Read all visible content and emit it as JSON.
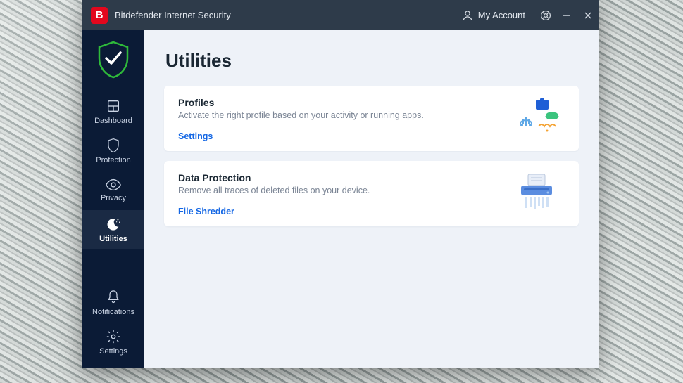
{
  "app": {
    "title": "Bitdefender Internet Security",
    "logo_letter": "B",
    "account_label": "My Account"
  },
  "sidebar": {
    "items": [
      {
        "key": "dashboard",
        "label": "Dashboard",
        "active": false
      },
      {
        "key": "protection",
        "label": "Protection",
        "active": false
      },
      {
        "key": "privacy",
        "label": "Privacy",
        "active": false
      },
      {
        "key": "utilities",
        "label": "Utilities",
        "active": true
      }
    ],
    "bottom_items": [
      {
        "key": "notifications",
        "label": "Notifications"
      },
      {
        "key": "settings",
        "label": "Settings"
      }
    ]
  },
  "page": {
    "title": "Utilities",
    "cards": [
      {
        "title": "Profiles",
        "desc": "Activate the right profile based on your activity or running apps.",
        "link": "Settings"
      },
      {
        "title": "Data Protection",
        "desc": "Remove all traces of deleted files on your device.",
        "link": "File Shredder"
      }
    ]
  }
}
